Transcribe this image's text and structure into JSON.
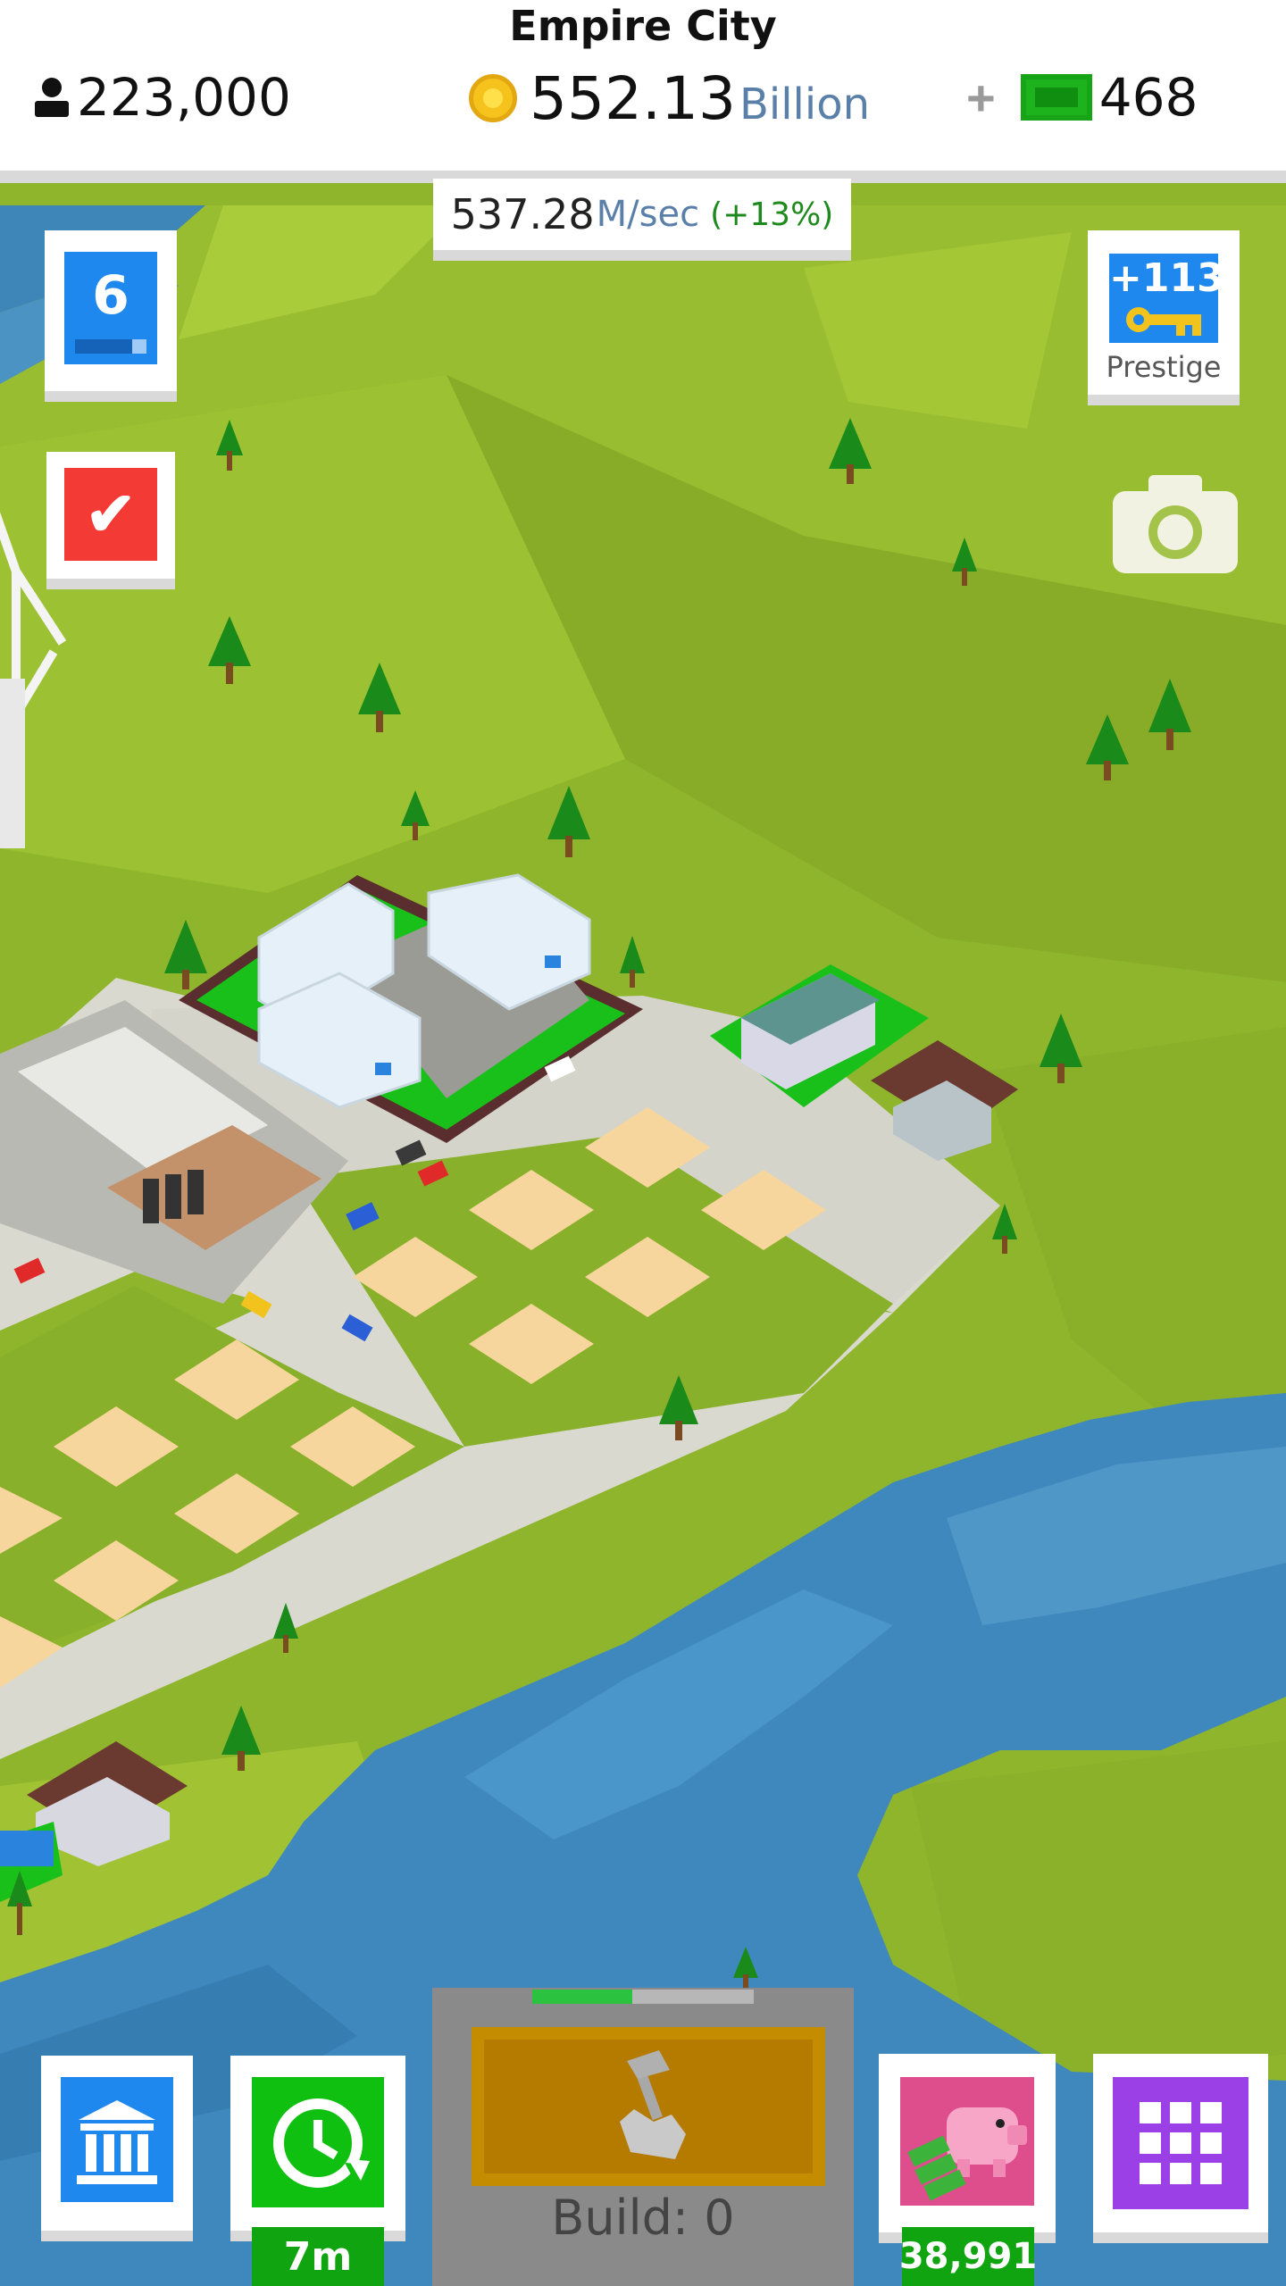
{
  "header": {
    "city_name": "Empire City",
    "population": "223,000",
    "money_value": "552.13",
    "money_unit": "Billion",
    "cash_plus": "+",
    "cash_amount": "468"
  },
  "income": {
    "value": "537.28",
    "unit": "M/sec",
    "bonus": "(+13%)"
  },
  "level": {
    "number": "6",
    "progress": 0.8
  },
  "prestige": {
    "value": "+113",
    "label": "Prestige"
  },
  "bottom": {
    "offline_time": "7m",
    "vault_amount": "38,991",
    "build_label": "Build: 0",
    "build_progress": 0.45
  },
  "icons": [
    "person-icon",
    "coin-icon",
    "cash-icon",
    "check-icon",
    "key-icon",
    "camera-icon",
    "bank-icon",
    "clock-refresh-icon",
    "piggy-bank-icon",
    "grid-menu-icon",
    "hammer-hand-icon"
  ],
  "colors": {
    "blue_button": "#1e88ee",
    "green_button": "#10c010",
    "red_button": "#f43a35",
    "purple_button": "#9b3fe6",
    "pink_button": "#de4d8c",
    "gold_build": "#b57a00"
  }
}
